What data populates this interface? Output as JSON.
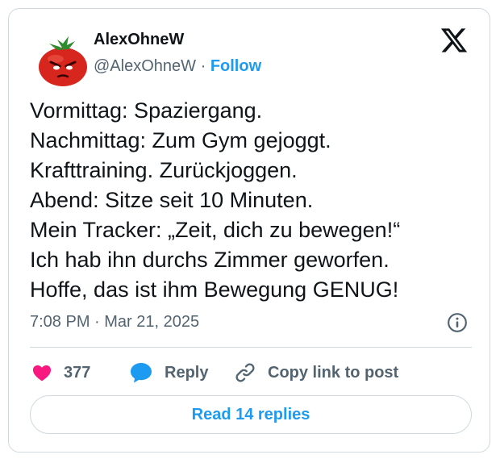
{
  "post": {
    "author_name": "AlexOhneW",
    "author_handle": "@AlexOhneW",
    "separator": "·",
    "follow_label": "Follow",
    "body_lines": [
      "Vormittag: Spaziergang.",
      "Nachmittag: Zum Gym gejoggt.",
      "Krafttraining. Zurückjoggen.",
      "Abend: Sitze seit 10 Minuten.",
      "Mein Tracker: „Zeit, dich zu bewegen!“",
      "Ich hab ihn durchs Zimmer geworfen.",
      "Hoffe, das ist ihm Bewegung GENUG!"
    ],
    "timestamp": "7:08 PM · Mar 21, 2025"
  },
  "actions": {
    "like_count": "377",
    "reply_label": "Reply",
    "copy_label": "Copy link to post",
    "read_replies_label": "Read 14 replies"
  },
  "icons": {
    "brand": "x-logo-icon",
    "info": "info-icon",
    "like": "heart-icon",
    "reply": "reply-bubble-icon",
    "copy": "link-icon",
    "avatar": "tomato-avatar-icon"
  },
  "colors": {
    "accent": "#1d9bf0",
    "like": "#f91880",
    "text": "#0f1419",
    "muted": "#536471",
    "border": "#cfd9de"
  }
}
